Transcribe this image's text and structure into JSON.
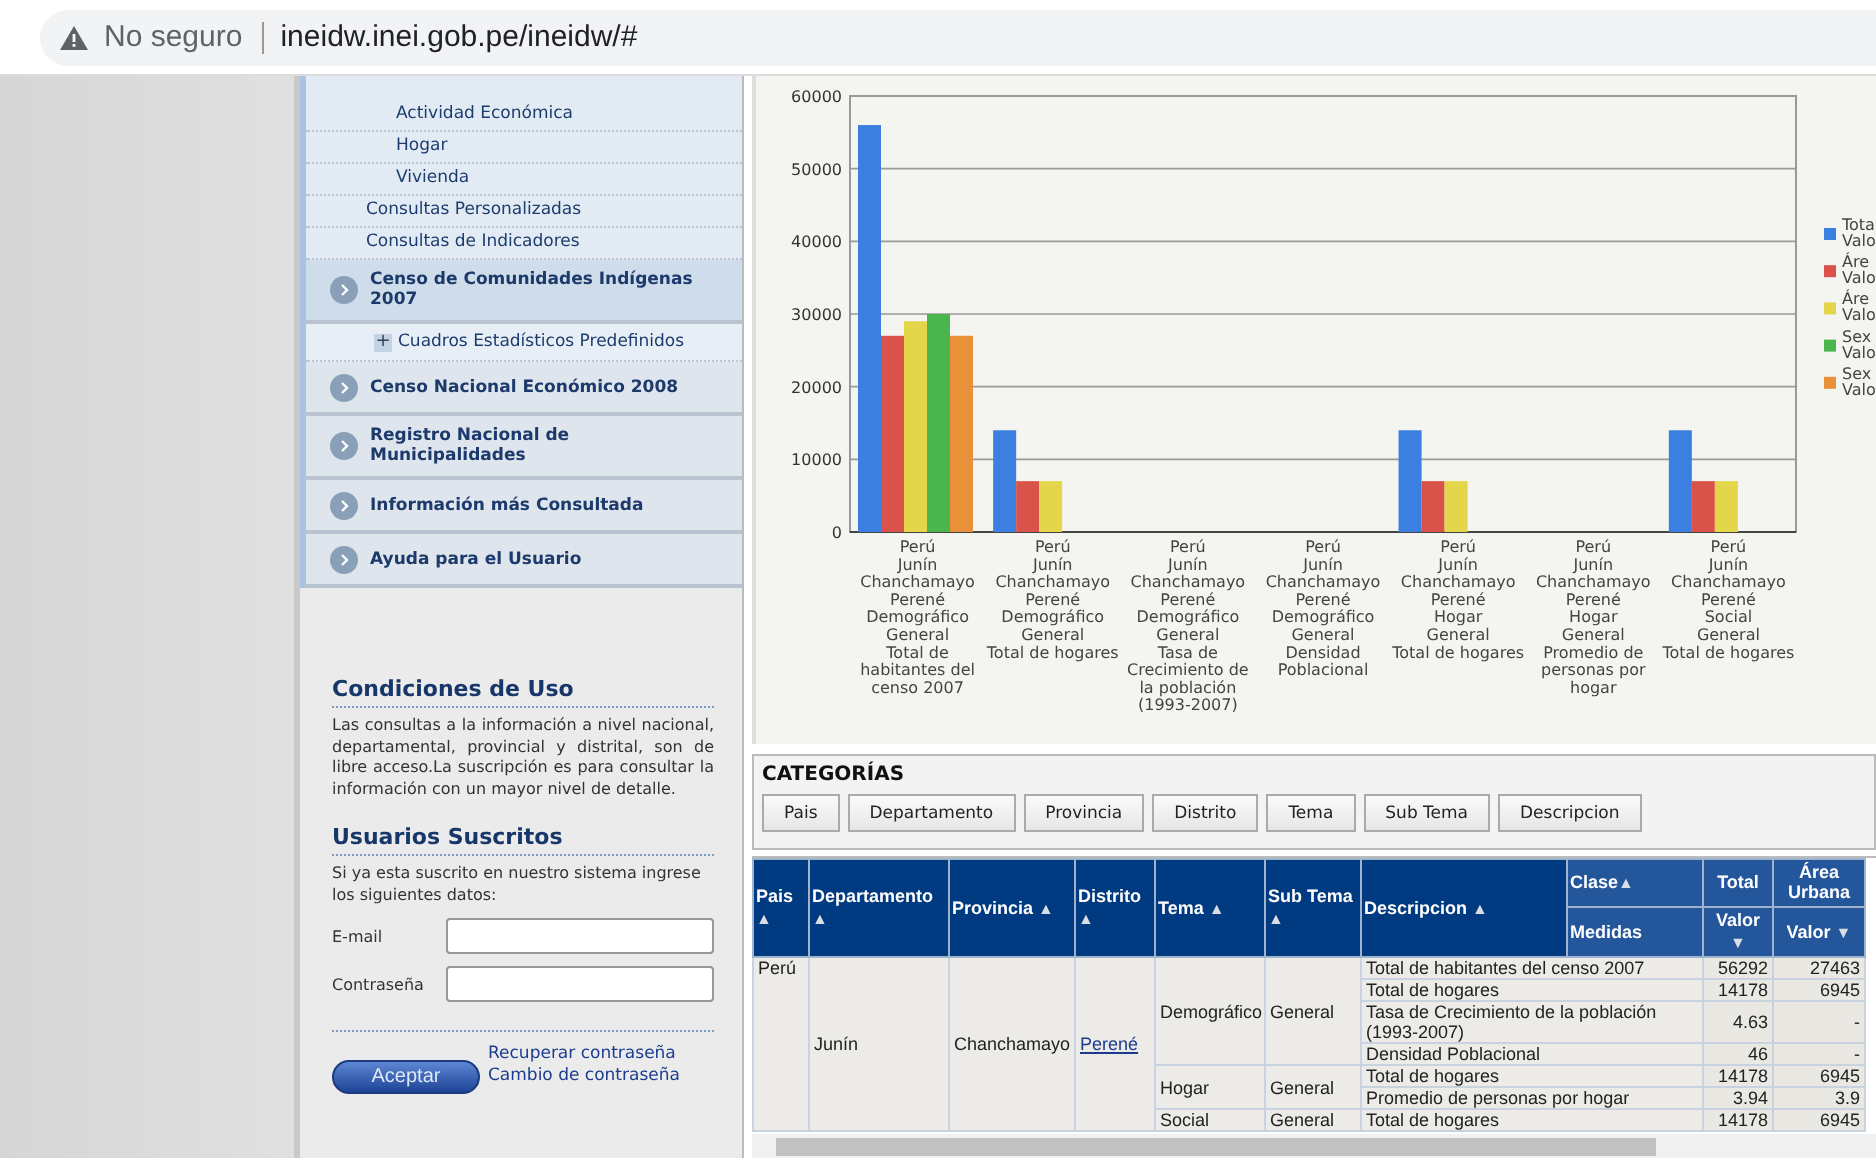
{
  "browser": {
    "security": "No seguro",
    "url": "ineidw.inei.gob.pe/ineidw/#"
  },
  "sidebar": {
    "items": [
      {
        "kind": "sub",
        "label": "Actividad Económica"
      },
      {
        "kind": "sub",
        "label": "Hogar"
      },
      {
        "kind": "sub",
        "label": "Vivienda"
      },
      {
        "kind": "link",
        "label": "Consultas Personalizadas"
      },
      {
        "kind": "link",
        "label": "Consultas de Indicadores"
      },
      {
        "kind": "section",
        "label": "Censo de Comunidades Indígenas 2007",
        "selected": true
      },
      {
        "kind": "tree",
        "label": "Cuadros Estadísticos Predefinidos",
        "expander": "+"
      },
      {
        "kind": "section",
        "label": "Censo Nacional Económico 2008",
        "selected": false
      },
      {
        "kind": "section",
        "label": "Registro Nacional de Municipalidades",
        "selected": false
      },
      {
        "kind": "section",
        "label": "Información más Consultada",
        "selected": false
      },
      {
        "kind": "section",
        "label": "Ayuda para el Usuario",
        "selected": false
      }
    ]
  },
  "terms": {
    "title": "Condiciones de Uso",
    "text": "Las consultas a la información a nivel nacional, departamental, provincial y distrital, son de libre acceso.La suscripción es para consultar la información con un mayor nivel de detalle."
  },
  "login": {
    "title": "Usuarios Suscritos",
    "intro": "Si ya esta suscrito en nuestro sistema ingrese los siguientes datos:",
    "email_label": "E-mail",
    "password_label": "Contraseña",
    "submit": "Aceptar",
    "links": [
      "Recuperar contraseña",
      "Cambio de contraseña"
    ]
  },
  "chart": {
    "chart_data": {
      "type": "bar",
      "categories": [
        "Perú\nJunín\nChanchamayo\nPerené\nDemográfico\nGeneral\nTotal de\nhabitantes del\ncenso 2007",
        "Perú\nJunín\nChanchamayo\nPerené\nDemográfico\nGeneral\nTotal de hogares",
        "Perú\nJunín\nChanchamayo\nPerené\nDemográfico\nGeneral\nTasa de\nCrecimiento de\nla población\n(1993-2007)",
        "Perú\nJunín\nChanchamayo\nPerené\nDemográfico\nGeneral\nDensidad\nPoblacional",
        "Perú\nJunín\nChanchamayo\nPerené\nHogar\nGeneral\nTotal de hogares",
        "Perú\nJunín\nChanchamayo\nPerené\nHogar\nGeneral\nPromedio de\npersonas por\nhogar",
        "Perú\nJunín\nChanchamayo\nPerené\nSocial\nGeneral\nTotal de hogares"
      ],
      "series": [
        {
          "name": "Tota\nValo",
          "color": "#3b7fe0",
          "values": [
            56000,
            14000,
            0,
            0,
            14000,
            0,
            14000
          ]
        },
        {
          "name": "Áre\nValo",
          "color": "#d9534a",
          "values": [
            27000,
            7000,
            null,
            null,
            7000,
            0,
            7000
          ]
        },
        {
          "name": "Áre\nValo",
          "color": "#e3d64a",
          "values": [
            29000,
            7000,
            null,
            null,
            7000,
            null,
            7000
          ]
        },
        {
          "name": "Sex\nValo",
          "color": "#4bb54e",
          "values": [
            30000,
            null,
            null,
            null,
            null,
            null,
            null
          ]
        },
        {
          "name": "Sex\nValo",
          "color": "#e8913a",
          "values": [
            27000,
            null,
            null,
            null,
            null,
            null,
            null
          ]
        }
      ],
      "grid": true,
      "legend": true,
      "ylim": [
        0,
        60000
      ],
      "yticks": [
        0,
        10000,
        20000,
        30000,
        40000,
        50000,
        60000
      ]
    }
  },
  "categories": {
    "title": "CATEGORÍAS",
    "buttons": [
      "Pais",
      "Departamento",
      "Provincia",
      "Distrito",
      "Tema",
      "Sub Tema",
      "Descripcion"
    ]
  },
  "table": {
    "columns": [
      {
        "label": "Pais",
        "sort": "▲"
      },
      {
        "label": "Departamento",
        "sort": "▲"
      },
      {
        "label": "Provincia",
        "sort": "▲"
      },
      {
        "label": "Distrito",
        "sort": "▲"
      },
      {
        "label": "Tema",
        "sort": "▲"
      },
      {
        "label": "Sub Tema",
        "sort": "▲"
      },
      {
        "label": "Descripcion",
        "sort": "▲"
      }
    ],
    "clase": {
      "label": "Clase",
      "sort": "▲"
    },
    "medidas": "Medidas",
    "measures": [
      {
        "group": "Total",
        "label": "Valor",
        "sort": "▼"
      },
      {
        "group": "Área\nUrbana",
        "label": "Valor",
        "sort": "▼"
      }
    ],
    "pais": "Perú",
    "departamento": "Junín",
    "provincia": "Chanchamayo",
    "distrito": "Perené",
    "temas": [
      {
        "tema": "Demográfico",
        "subtema": "General",
        "rows": [
          {
            "descripcion": "Total de habitantes del censo 2007",
            "values": [
              "56292",
              "27463"
            ]
          },
          {
            "descripcion": "Total de hogares",
            "values": [
              "14178",
              "6945"
            ]
          },
          {
            "descripcion": "Tasa de Crecimiento de la población (1993-2007)",
            "values": [
              "4.63",
              "-"
            ]
          },
          {
            "descripcion": "Densidad Poblacional",
            "values": [
              "46",
              "-"
            ]
          }
        ]
      },
      {
        "tema": "Hogar",
        "subtema": "General",
        "rows": [
          {
            "descripcion": "Total de hogares",
            "values": [
              "14178",
              "6945"
            ]
          },
          {
            "descripcion": "Promedio de personas por hogar",
            "values": [
              "3.94",
              "3.9"
            ]
          }
        ]
      },
      {
        "tema": "Social",
        "subtema": "General",
        "rows": [
          {
            "descripcion": "Total de hogares",
            "values": [
              "14178",
              "6945"
            ]
          }
        ]
      }
    ]
  }
}
